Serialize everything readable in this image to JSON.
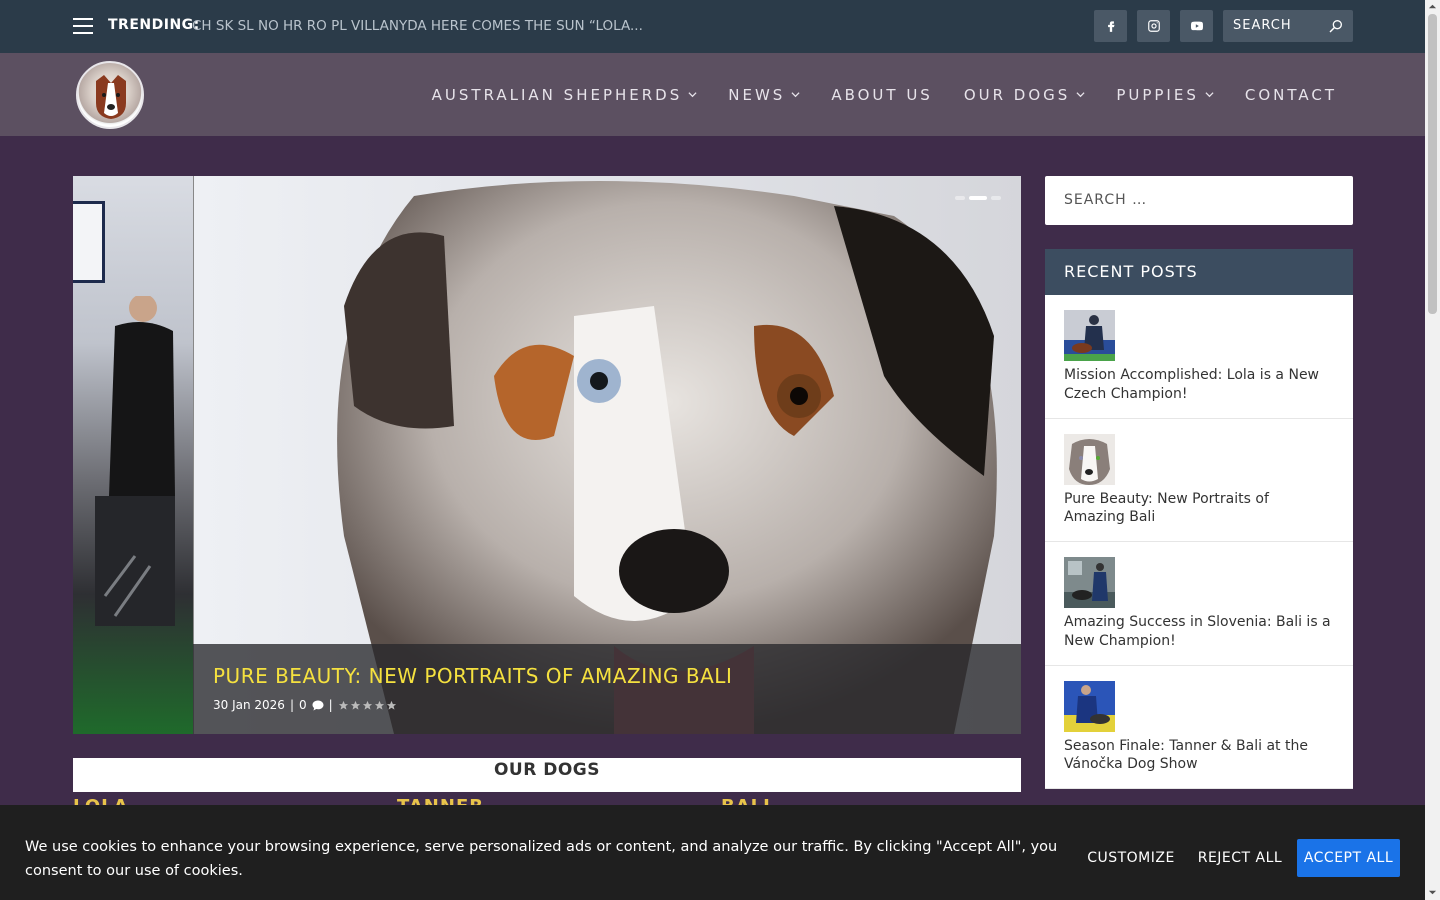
{
  "topbar": {
    "trending_label": "TRENDING:",
    "trending_text": "CH SK SL NO HR RO PL VILLANYDA HERE COMES THE SUN “LOLA...",
    "search_placeholder": "SEARCH",
    "social": [
      "facebook-icon",
      "instagram-icon",
      "youtube-icon"
    ]
  },
  "nav": {
    "items": [
      {
        "label": "AUSTRALIAN SHEPHERDS",
        "dropdown": true
      },
      {
        "label": "NEWS",
        "dropdown": true
      },
      {
        "label": "ABOUT US",
        "dropdown": false
      },
      {
        "label": "OUR DOGS",
        "dropdown": true
      },
      {
        "label": "PUPPIES",
        "dropdown": true
      },
      {
        "label": "CONTACT",
        "dropdown": false
      }
    ]
  },
  "slider": {
    "title": "PURE BEAUTY: NEW PORTRAITS OF AMAZING BALI",
    "date": "30 Jan 2026",
    "comments": "0",
    "separator": "|",
    "rating_stars": 5
  },
  "our_dogs": {
    "heading": "OUR DOGS",
    "names": [
      "LOLA",
      "TANNER",
      "BALI"
    ]
  },
  "sidebar": {
    "search_placeholder": "SEARCH …",
    "recent_heading": "RECENT POSTS",
    "recent_posts": [
      {
        "title": "Mission Accomplished: Lola is a New Czech Champion!"
      },
      {
        "title": "Pure Beauty: New Portraits of Amazing Bali"
      },
      {
        "title": "Amazing Success in Slovenia: Bali is a New Champion!"
      },
      {
        "title": "Season Finale: Tanner & Bali at the Vánočka Dog Show"
      }
    ]
  },
  "cookie": {
    "text": "We use cookies to enhance your browsing experience, serve personalized ads or content, and analyze our traffic. By clicking \"Accept All\", you consent to our use of cookies.",
    "customize": "CUSTOMIZE",
    "reject": "REJECT ALL",
    "accept": "ACCEPT ALL"
  },
  "colors": {
    "topbar": "#2b3b49",
    "header": "#5c5061",
    "background": "#3f2c4a",
    "accent_yellow": "#f5e13f",
    "accept_blue": "#1a73e8"
  }
}
